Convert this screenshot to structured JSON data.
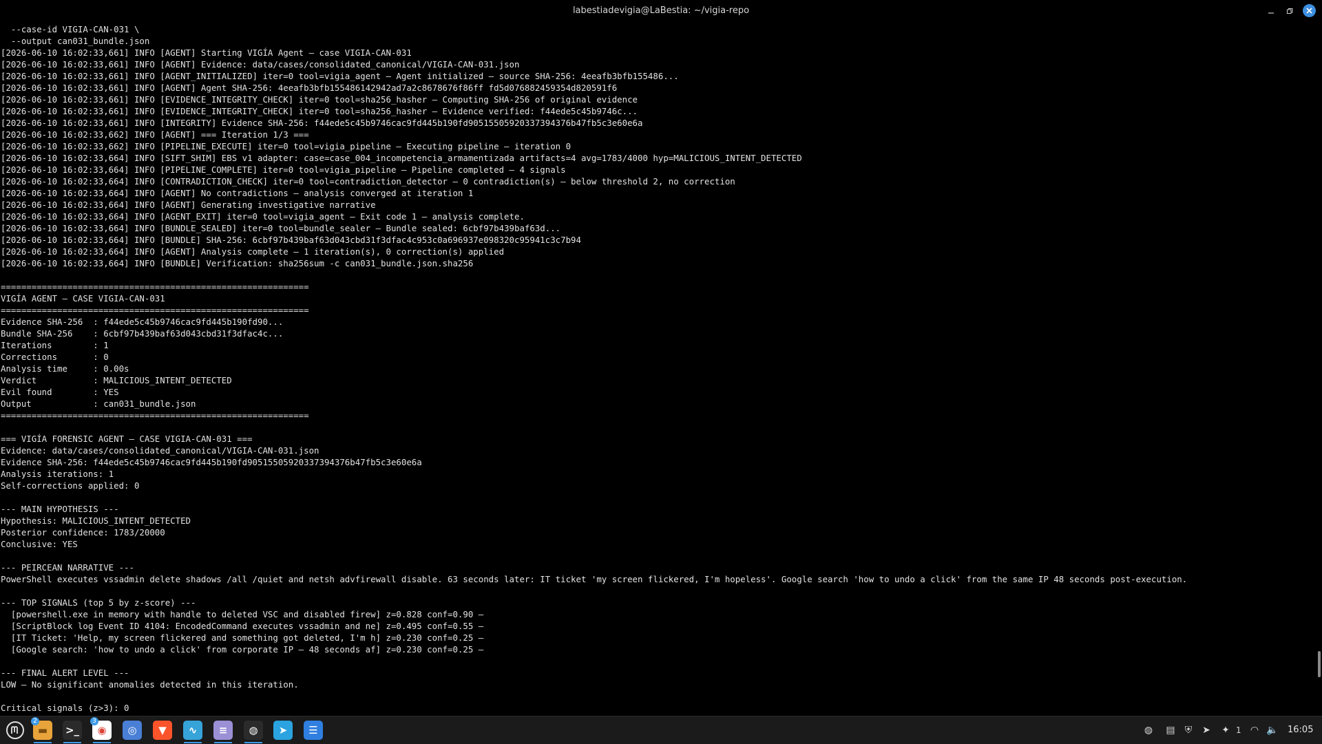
{
  "window": {
    "title": "labestiadevigia@LaBestia: ~/vigia-repo"
  },
  "terminal": {
    "lines": [
      "  --case-id VIGIA-CAN-031 \\",
      "  --output can031_bundle.json",
      "[2026-06-10 16:02:33,661] INFO [AGENT] Starting VIGÍA Agent — case VIGIA-CAN-031",
      "[2026-06-10 16:02:33,661] INFO [AGENT] Evidence: data/cases/consolidated_canonical/VIGIA-CAN-031.json",
      "[2026-06-10 16:02:33,661] INFO [AGENT_INITIALIZED] iter=0 tool=vigia_agent — Agent initialized — source SHA-256: 4eeafb3bfb155486...",
      "[2026-06-10 16:02:33,661] INFO [AGENT] Agent SHA-256: 4eeafb3bfb155486142942ad7a2c8678676f86ff fd5d076882459354d820591f6",
      "[2026-06-10 16:02:33,661] INFO [EVIDENCE_INTEGRITY_CHECK] iter=0 tool=sha256_hasher — Computing SHA-256 of original evidence",
      "[2026-06-10 16:02:33,661] INFO [EVIDENCE_INTEGRITY_CHECK] iter=0 tool=sha256_hasher — Evidence verified: f44ede5c45b9746c...",
      "[2026-06-10 16:02:33,661] INFO [INTEGRITY] Evidence SHA-256: f44ede5c45b9746cac9fd445b190fd90515505920337394376b47fb5c3e60e6a",
      "[2026-06-10 16:02:33,662] INFO [AGENT] === Iteration 1/3 ===",
      "[2026-06-10 16:02:33,662] INFO [PIPELINE_EXECUTE] iter=0 tool=vigia_pipeline — Executing pipeline — iteration 0",
      "[2026-06-10 16:02:33,664] INFO [SIFT_SHIM] EBS v1 adapter: case=case_004_incompetencia_armamentizada artifacts=4 avg=1783/4000 hyp=MALICIOUS_INTENT_DETECTED",
      "[2026-06-10 16:02:33,664] INFO [PIPELINE_COMPLETE] iter=0 tool=vigia_pipeline — Pipeline completed — 4 signals",
      "[2026-06-10 16:02:33,664] INFO [CONTRADICTION_CHECK] iter=0 tool=contradiction_detector — 0 contradiction(s) — below threshold 2, no correction",
      "[2026-06-10 16:02:33,664] INFO [AGENT] No contradictions — analysis converged at iteration 1",
      "[2026-06-10 16:02:33,664] INFO [AGENT] Generating investigative narrative",
      "[2026-06-10 16:02:33,664] INFO [AGENT_EXIT] iter=0 tool=vigia_agent — Exit code 1 — analysis complete.",
      "[2026-06-10 16:02:33,664] INFO [BUNDLE_SEALED] iter=0 tool=bundle_sealer — Bundle sealed: 6cbf97b439baf63d...",
      "[2026-06-10 16:02:33,664] INFO [BUNDLE] SHA-256: 6cbf97b439baf63d043cbd31f3dfac4c953c0a696937e098320c95941c3c7b94",
      "[2026-06-10 16:02:33,664] INFO [AGENT] Analysis complete — 1 iteration(s), 0 correction(s) applied",
      "[2026-06-10 16:02:33,664] INFO [BUNDLE] Verification: sha256sum -c can031_bundle.json.sha256",
      "",
      "============================================================",
      "VIGÍA AGENT — CASE VIGIA-CAN-031",
      "============================================================",
      "Evidence SHA-256  : f44ede5c45b9746cac9fd445b190fd90...",
      "Bundle SHA-256    : 6cbf97b439baf63d043cbd31f3dfac4c...",
      "Iterations        : 1",
      "Corrections       : 0",
      "Analysis time     : 0.00s",
      "Verdict           : MALICIOUS_INTENT_DETECTED",
      "Evil found        : YES",
      "Output            : can031_bundle.json",
      "============================================================",
      "",
      "=== VIGÍA FORENSIC AGENT — CASE VIGIA-CAN-031 ===",
      "Evidence: data/cases/consolidated_canonical/VIGIA-CAN-031.json",
      "Evidence SHA-256: f44ede5c45b9746cac9fd445b190fd90515505920337394376b47fb5c3e60e6a",
      "Analysis iterations: 1",
      "Self-corrections applied: 0",
      "",
      "--- MAIN HYPOTHESIS ---",
      "Hypothesis: MALICIOUS_INTENT_DETECTED",
      "Posterior confidence: 1783/20000",
      "Conclusive: YES",
      "",
      "--- PEIRCEAN NARRATIVE ---",
      "PowerShell executes vssadmin delete shadows /all /quiet and netsh advfirewall disable. 63 seconds later: IT ticket 'my screen flickered, I'm hopeless'. Google search 'how to undo a click' from the same IP 48 seconds post-execution.",
      "",
      "--- TOP SIGNALS (top 5 by z-score) ---",
      "  [powershell.exe in memory with handle to deleted VSC and disabled firew] z=0.828 conf=0.90 —",
      "  [ScriptBlock log Event ID 4104: EncodedCommand executes vssadmin and ne] z=0.495 conf=0.55 —",
      "  [IT Ticket: 'Help, my screen flickered and something got deleted, I'm h] z=0.230 conf=0.25 —",
      "  [Google search: 'how to undo a click' from corporate IP — 48 seconds af] z=0.230 conf=0.25 —",
      "",
      "--- FINAL ALERT LEVEL ---",
      "LOW — No significant anomalies detected in this iteration.",
      "",
      "Critical signals (z>3): 0"
    ]
  },
  "taskbar": {
    "menu_icon": "mint-menu-icon",
    "apps": [
      {
        "name": "files-icon",
        "badge": "2",
        "glyph": "▬",
        "bg": "#e8a33a",
        "fg": "#7a4d10",
        "running": true
      },
      {
        "name": "terminal-icon",
        "badge": "",
        "glyph": ">_",
        "bg": "#2b2b2b",
        "fg": "#ffffff",
        "running": true
      },
      {
        "name": "chrome-icon",
        "badge": "3",
        "glyph": "◉",
        "bg": "#ffffff",
        "fg": "#db4437",
        "running": true
      },
      {
        "name": "screenshot-icon",
        "badge": "",
        "glyph": "◎",
        "bg": "#4a7fd6",
        "fg": "#ffffff",
        "running": false
      },
      {
        "name": "brave-icon",
        "badge": "",
        "glyph": "▼",
        "bg": "#fb542b",
        "fg": "#ffffff",
        "running": false
      },
      {
        "name": "system-monitor-icon",
        "badge": "",
        "glyph": "∿",
        "bg": "#36a3d9",
        "fg": "#ffffff",
        "running": true
      },
      {
        "name": "text-editor-icon",
        "badge": "",
        "glyph": "≡",
        "bg": "#9b8fd6",
        "fg": "#ffffff",
        "running": true
      },
      {
        "name": "obs-icon",
        "badge": "",
        "glyph": "◍",
        "bg": "#2b2b2b",
        "fg": "#ffffff",
        "running": true
      },
      {
        "name": "telegram-icon",
        "badge": "",
        "glyph": "➤",
        "bg": "#2aa3e0",
        "fg": "#ffffff",
        "running": false
      },
      {
        "name": "notes-icon",
        "badge": "",
        "glyph": "☰",
        "bg": "#2f7fe0",
        "fg": "#ffffff",
        "running": false
      }
    ],
    "tray": [
      {
        "name": "obs-tray-icon",
        "glyph": "◍"
      },
      {
        "name": "clipboard-icon",
        "glyph": "▤"
      },
      {
        "name": "shield-icon",
        "glyph": "⛨"
      },
      {
        "name": "telegram-tray-icon",
        "glyph": "➤"
      },
      {
        "name": "notification-icon",
        "glyph": "✦"
      }
    ],
    "notification_count": "1",
    "status_tray": [
      {
        "name": "wifi-icon",
        "glyph": "◠"
      },
      {
        "name": "volume-icon",
        "glyph": "🔈"
      }
    ],
    "clock": "16:05"
  }
}
